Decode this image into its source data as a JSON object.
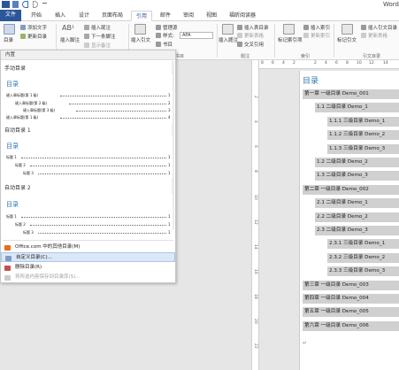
{
  "window": {
    "title_right": "Word"
  },
  "qat": {
    "icons": [
      "word-logo-icon",
      "save-icon",
      "undo-icon",
      "redo-icon",
      "customize-icon"
    ]
  },
  "tabs": [
    {
      "label": "文件"
    },
    {
      "label": "开始"
    },
    {
      "label": "插入"
    },
    {
      "label": "设计"
    },
    {
      "label": "页面布局"
    },
    {
      "label": "引用"
    },
    {
      "label": "邮件"
    },
    {
      "label": "审阅"
    },
    {
      "label": "视图"
    },
    {
      "label": "福昕阅读器"
    }
  ],
  "ribbon": {
    "toc_button": "目录",
    "add_text": "添加文字",
    "update_toc": "更新目录",
    "insert_footnote": "插入脚注",
    "insert_endnote": "插入尾注",
    "next_footnote": "下一条脚注",
    "show_notes": "显示备注",
    "insert_citation": "插入引文",
    "manage_sources": "管理源",
    "style_label": "样式:",
    "style_value": "APA",
    "bibliography": "书目",
    "citations_group": "书目",
    "insert_caption": "插入题注",
    "insert_table_of_figures": "插入表目录",
    "update_table": "更新表格",
    "cross_reference": "交叉引用",
    "captions_group": "题注",
    "mark_entry": "标记索引项",
    "insert_index": "插入索引",
    "update_index": "更新索引",
    "index_group": "索引",
    "mark_citation": "标记引文",
    "insert_table_of_authorities": "插入引文目录",
    "update_table2": "更新表格",
    "authorities_group": "引文目录"
  },
  "gallery": {
    "header": "内置",
    "sections": [
      {
        "label": "手动目录",
        "title": "目录",
        "lines": [
          "键入章标题(第 1 级)",
          "键入章标题(第 2 级)",
          "键入章标题(第 3 级)",
          "键入章标题(第 1 级)"
        ],
        "nums": [
          "1",
          "2",
          "3",
          "4"
        ]
      },
      {
        "label": "自动目录 1",
        "title": "目录",
        "lines": [
          "标题 1",
          "标题 2",
          "标题 3"
        ],
        "nums": [
          "1",
          "1",
          "1"
        ]
      },
      {
        "label": "自动目录 2",
        "title": "目录",
        "lines": [
          "标题 1",
          "标题 2",
          "标题 3"
        ],
        "nums": [
          "1",
          "1",
          "1"
        ]
      }
    ],
    "menu": [
      {
        "label": "Office.com 中的其他目录(M)",
        "state": "normal"
      },
      {
        "label": "自定义目录(C)...",
        "state": "highlighted"
      },
      {
        "label": "删除目录(R)",
        "state": "normal"
      },
      {
        "label": "将所选内容保存到目录库(S)...",
        "state": "disabled"
      }
    ]
  },
  "ruler": {
    "h_ticks": [
      "8",
      "6",
      "4",
      "2",
      "",
      "2",
      "4",
      "6",
      "8",
      "10",
      "12",
      "14"
    ],
    "v_ticks": [
      "2",
      "4",
      "6",
      "8",
      "10",
      "12",
      "14",
      "16",
      "18",
      "20",
      "22"
    ]
  },
  "document": {
    "toc_title": "目录",
    "entries": [
      {
        "text": "第一章 一级目录 Demo_001",
        "level": 1
      },
      {
        "text": "1.1 二级目录 Demo_1",
        "level": 2
      },
      {
        "text": "1.1.1 三级目录 Demo_1",
        "level": 3
      },
      {
        "text": "1.1.2 三级目录 Demo_2",
        "level": 3
      },
      {
        "text": "1.1.3 三级目录 Demo_3",
        "level": 3
      },
      {
        "text": "1.2 二级目录 Demo_2",
        "level": 2
      },
      {
        "text": "1.3 二级目录 Demo_3",
        "level": 2
      },
      {
        "text": "第二章 一级目录 Demo_002",
        "level": 1
      },
      {
        "text": "2.1 二级目录 Demo_1",
        "level": 2
      },
      {
        "text": "2.2 二级目录 Demo_2",
        "level": 2
      },
      {
        "text": "2.3 二级目录 Demo_3",
        "level": 2
      },
      {
        "text": "2.3.1 三级目录 Demo_1",
        "level": 3
      },
      {
        "text": "2.3.2 三级目录 Demo_2",
        "level": 3
      },
      {
        "text": "2.3.3 三级目录 Demo_3",
        "level": 3
      },
      {
        "text": "第三章 一级目录 Demo_003",
        "level": 1
      },
      {
        "text": "第四章 一级目录 Demo_004",
        "level": 1
      },
      {
        "text": "第五章 一级目录 Demo_005",
        "level": 1
      },
      {
        "text": "第六章 一级目录 Demo_006",
        "level": 1
      }
    ],
    "end_mark": "↵"
  },
  "colors": {
    "file_tab": "#2b579a",
    "heading_blue": "#2e74b5",
    "toc_field_gray": "#d0d0d0",
    "menu_highlight": "#dbe7f6"
  }
}
